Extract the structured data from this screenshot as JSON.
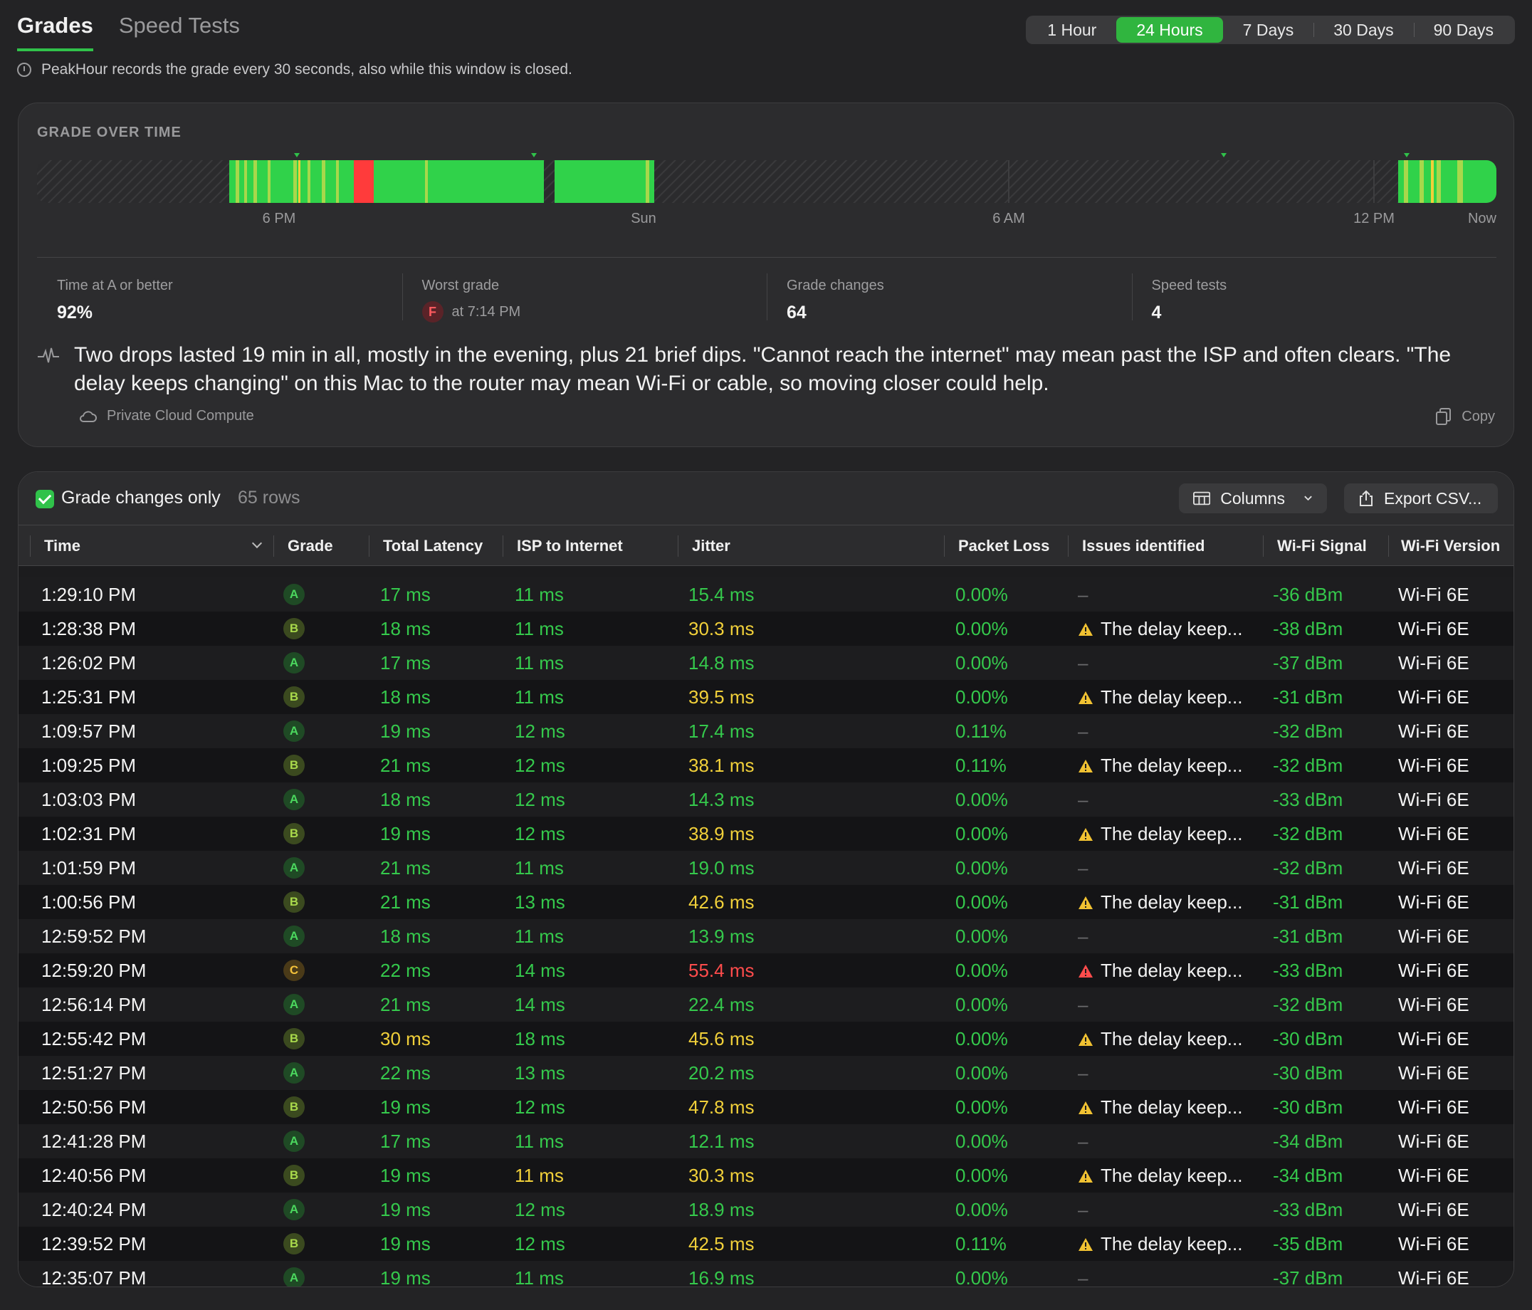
{
  "tabs": [
    {
      "label": "Grades",
      "active": true
    },
    {
      "label": "Speed Tests",
      "active": false
    }
  ],
  "ranges": [
    {
      "label": "1 Hour",
      "selected": false
    },
    {
      "label": "24 Hours",
      "selected": true
    },
    {
      "label": "7 Days",
      "selected": false
    },
    {
      "label": "30 Days",
      "selected": false
    },
    {
      "label": "90 Days",
      "selected": false
    }
  ],
  "notice": "PeakHour records the grade every 30 seconds, also while this window is closed.",
  "overview": {
    "title": "GRADE OVER TIME",
    "axis_labels": [
      "6 PM",
      "Sun",
      "6 AM",
      "12 PM",
      "Now"
    ],
    "stats": {
      "time_a": {
        "label": "Time at A or better",
        "value": "92%"
      },
      "worst": {
        "label": "Worst grade",
        "grade": "F",
        "time": "at 7:14 PM"
      },
      "changes": {
        "label": "Grade changes",
        "value": "64"
      },
      "speed": {
        "label": "Speed tests",
        "value": "4"
      }
    },
    "summary": "Two drops lasted 19 min in all, mostly in the evening, plus 21 brief dips. \"Cannot reach the internet\" may mean past the ISP and often clears. \"The delay keeps changing\" on this Mac to the router may mean Wi-Fi or cable, so moving closer could help.",
    "source": "Private Cloud Compute",
    "copy_label": "Copy"
  },
  "table": {
    "filter_label": "Grade changes only",
    "rows_count": "65 rows",
    "columns_button": "Columns",
    "export_button": "Export CSV...",
    "headers": [
      "Time",
      "Grade",
      "Total Latency",
      "ISP to Internet",
      "Jitter",
      "Packet Loss",
      "Issues identified",
      "Wi-Fi Signal",
      "Wi-Fi Version"
    ],
    "rows": [
      {
        "time": "1:29:10 PM",
        "grade": "A",
        "latency": "17 ms",
        "isp": "11 ms",
        "jitter": "15.4 ms",
        "jitter_color": "green",
        "loss": "0.00%",
        "issue": "–",
        "issue_level": "none",
        "signal": "-36 dBm",
        "version": "Wi-Fi 6E"
      },
      {
        "time": "1:28:38 PM",
        "grade": "B",
        "latency": "18 ms",
        "isp": "11 ms",
        "jitter": "30.3 ms",
        "jitter_color": "yellow",
        "loss": "0.00%",
        "issue": "The delay keep...",
        "issue_level": "warn",
        "signal": "-38 dBm",
        "version": "Wi-Fi 6E"
      },
      {
        "time": "1:26:02 PM",
        "grade": "A",
        "latency": "17 ms",
        "isp": "11 ms",
        "jitter": "14.8 ms",
        "jitter_color": "green",
        "loss": "0.00%",
        "issue": "–",
        "issue_level": "none",
        "signal": "-37 dBm",
        "version": "Wi-Fi 6E"
      },
      {
        "time": "1:25:31 PM",
        "grade": "B",
        "latency": "18 ms",
        "isp": "11 ms",
        "jitter": "39.5 ms",
        "jitter_color": "yellow",
        "loss": "0.00%",
        "issue": "The delay keep...",
        "issue_level": "warn",
        "signal": "-31 dBm",
        "version": "Wi-Fi 6E"
      },
      {
        "time": "1:09:57 PM",
        "grade": "A",
        "latency": "19 ms",
        "isp": "12 ms",
        "jitter": "17.4 ms",
        "jitter_color": "green",
        "loss": "0.11%",
        "issue": "–",
        "issue_level": "none",
        "signal": "-32 dBm",
        "version": "Wi-Fi 6E"
      },
      {
        "time": "1:09:25 PM",
        "grade": "B",
        "latency": "21 ms",
        "isp": "12 ms",
        "jitter": "38.1 ms",
        "jitter_color": "yellow",
        "loss": "0.11%",
        "issue": "The delay keep...",
        "issue_level": "warn",
        "signal": "-32 dBm",
        "version": "Wi-Fi 6E"
      },
      {
        "time": "1:03:03 PM",
        "grade": "A",
        "latency": "18 ms",
        "isp": "12 ms",
        "jitter": "14.3 ms",
        "jitter_color": "green",
        "loss": "0.00%",
        "issue": "–",
        "issue_level": "none",
        "signal": "-33 dBm",
        "version": "Wi-Fi 6E"
      },
      {
        "time": "1:02:31 PM",
        "grade": "B",
        "latency": "19 ms",
        "isp": "12 ms",
        "jitter": "38.9 ms",
        "jitter_color": "yellow",
        "loss": "0.00%",
        "issue": "The delay keep...",
        "issue_level": "warn",
        "signal": "-32 dBm",
        "version": "Wi-Fi 6E"
      },
      {
        "time": "1:01:59 PM",
        "grade": "A",
        "latency": "21 ms",
        "isp": "11 ms",
        "jitter": "19.0 ms",
        "jitter_color": "green",
        "loss": "0.00%",
        "issue": "–",
        "issue_level": "none",
        "signal": "-32 dBm",
        "version": "Wi-Fi 6E"
      },
      {
        "time": "1:00:56 PM",
        "grade": "B",
        "latency": "21 ms",
        "isp": "13 ms",
        "jitter": "42.6 ms",
        "jitter_color": "yellow",
        "loss": "0.00%",
        "issue": "The delay keep...",
        "issue_level": "warn",
        "signal": "-31 dBm",
        "version": "Wi-Fi 6E"
      },
      {
        "time": "12:59:52 PM",
        "grade": "A",
        "latency": "18 ms",
        "isp": "11 ms",
        "jitter": "13.9 ms",
        "jitter_color": "green",
        "loss": "0.00%",
        "issue": "–",
        "issue_level": "none",
        "signal": "-31 dBm",
        "version": "Wi-Fi 6E"
      },
      {
        "time": "12:59:20 PM",
        "grade": "C",
        "latency": "22 ms",
        "isp": "14 ms",
        "jitter": "55.4 ms",
        "jitter_color": "red",
        "loss": "0.00%",
        "issue": "The delay keep...",
        "issue_level": "severe",
        "signal": "-33 dBm",
        "version": "Wi-Fi 6E"
      },
      {
        "time": "12:56:14 PM",
        "grade": "A",
        "latency": "21 ms",
        "isp": "14 ms",
        "jitter": "22.4 ms",
        "jitter_color": "green",
        "loss": "0.00%",
        "issue": "–",
        "issue_level": "none",
        "signal": "-32 dBm",
        "version": "Wi-Fi 6E"
      },
      {
        "time": "12:55:42 PM",
        "grade": "B",
        "latency": "30 ms",
        "isp": "18 ms",
        "jitter": "45.6 ms",
        "jitter_color": "yellow",
        "loss": "0.00%",
        "issue": "The delay keep...",
        "issue_level": "warn",
        "signal": "-30 dBm",
        "version": "Wi-Fi 6E"
      },
      {
        "time": "12:51:27 PM",
        "grade": "A",
        "latency": "22 ms",
        "isp": "13 ms",
        "jitter": "20.2 ms",
        "jitter_color": "green",
        "loss": "0.00%",
        "issue": "–",
        "issue_level": "none",
        "signal": "-30 dBm",
        "version": "Wi-Fi 6E"
      },
      {
        "time": "12:50:56 PM",
        "grade": "B",
        "latency": "19 ms",
        "isp": "12 ms",
        "jitter": "47.8 ms",
        "jitter_color": "yellow",
        "loss": "0.00%",
        "issue": "The delay keep...",
        "issue_level": "warn",
        "signal": "-30 dBm",
        "version": "Wi-Fi 6E"
      },
      {
        "time": "12:41:28 PM",
        "grade": "A",
        "latency": "17 ms",
        "isp": "11 ms",
        "jitter": "12.1 ms",
        "jitter_color": "green",
        "loss": "0.00%",
        "issue": "–",
        "issue_level": "none",
        "signal": "-34 dBm",
        "version": "Wi-Fi 6E"
      },
      {
        "time": "12:40:56 PM",
        "grade": "B",
        "latency": "19 ms",
        "isp": "11 ms",
        "jitter": "30.3 ms",
        "jitter_color": "yellow",
        "loss": "0.00%",
        "issue": "The delay keep...",
        "issue_level": "warn",
        "signal": "-34 dBm",
        "version": "Wi-Fi 6E"
      },
      {
        "time": "12:40:24 PM",
        "grade": "A",
        "latency": "19 ms",
        "isp": "12 ms",
        "jitter": "18.9 ms",
        "jitter_color": "green",
        "loss": "0.00%",
        "issue": "–",
        "issue_level": "none",
        "signal": "-33 dBm",
        "version": "Wi-Fi 6E"
      },
      {
        "time": "12:39:52 PM",
        "grade": "B",
        "latency": "19 ms",
        "isp": "12 ms",
        "jitter": "42.5 ms",
        "jitter_color": "yellow",
        "loss": "0.11%",
        "issue": "The delay keep...",
        "issue_level": "warn",
        "signal": "-35 dBm",
        "version": "Wi-Fi 6E"
      },
      {
        "time": "12:35:07 PM",
        "grade": "A",
        "latency": "19 ms",
        "isp": "11 ms",
        "jitter": "16.9 ms",
        "jitter_color": "green",
        "loss": "0.00%",
        "issue": "–",
        "issue_level": "none",
        "signal": "-37 dBm",
        "version": "Wi-Fi 6E"
      }
    ]
  },
  "colors": {
    "accent": "#30c24a",
    "grade_a": "#35c94c",
    "grade_b": "#a8d84b",
    "grade_c": "#f1d03a",
    "grade_f": "#ff4c4c"
  }
}
